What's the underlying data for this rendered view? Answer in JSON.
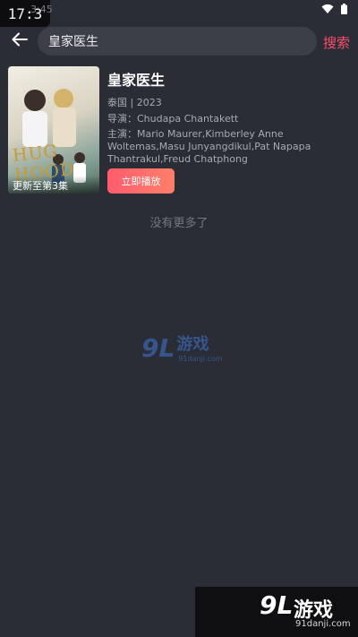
{
  "status_bar": {
    "time_badge": "17:3",
    "time_faint": "3:45"
  },
  "search": {
    "query": "皇家医生",
    "button_label": "搜索"
  },
  "result": {
    "title": "皇家医生",
    "meta": "泰国 | 2023",
    "director": "导演：Chudapa Chantakett",
    "cast": "主演：Mario Maurer,Kimberley Anne Woltemas,Masu Junyangdikul,Pat Napapa Thantrakul,Freud Chatphong",
    "poster_caption": "更新至第3集",
    "poster_title_art": "HUG HOOD",
    "play_label": "立即播放"
  },
  "footer_text": "没有更多了",
  "watermarks": {
    "center": {
      "mark": "9L",
      "brand": "游戏",
      "url": "91danji.com"
    },
    "corner": {
      "mark": "9L",
      "brand": "游戏",
      "url": "91danji.com"
    }
  },
  "colors": {
    "background": "#2b2d36",
    "accent": "#ff4d6a",
    "play_gradient_start": "#ff5c6e",
    "play_gradient_end": "#ff7f6a"
  }
}
